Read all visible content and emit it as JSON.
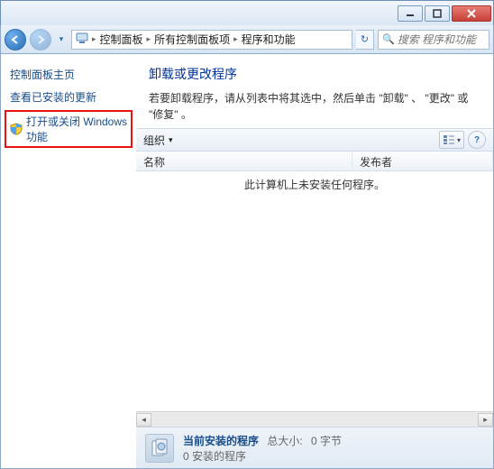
{
  "titlebar": {},
  "nav": {
    "breadcrumb": [
      "控制面板",
      "所有控制面板项",
      "程序和功能"
    ],
    "search_placeholder": "搜索 程序和功能"
  },
  "sidebar": {
    "home": "控制面板主页",
    "updates": "查看已安装的更新",
    "win_features": "打开或关闭 Windows 功能"
  },
  "main": {
    "heading": "卸载或更改程序",
    "subtext": "若要卸载程序，请从列表中将其选中，然后单击 \"卸载\" 、 \"更改\" 或 \"修复\" 。",
    "toolbar": {
      "organize": "组织"
    },
    "columns": {
      "name": "名称",
      "publisher": "发布者"
    },
    "empty_msg": "此计算机上未安装任何程序。"
  },
  "footer": {
    "title": "当前安装的程序",
    "size_label": "总大小:",
    "size_value": "0 字节",
    "count": "0 安装的程序"
  }
}
